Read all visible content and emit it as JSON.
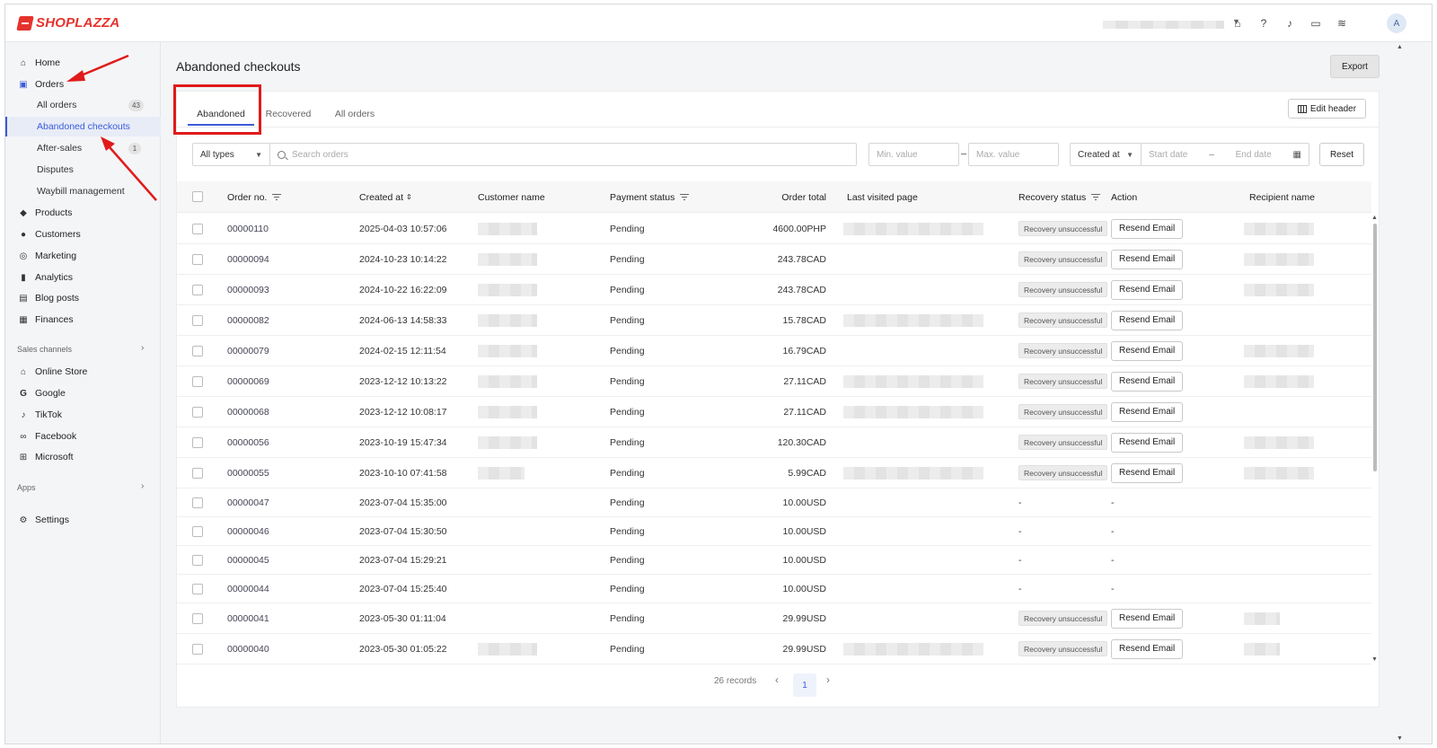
{
  "app": {
    "brand": "SHOPLAZZA",
    "avatar_initial": "A"
  },
  "topbar": {
    "icons": [
      "store-icon",
      "help-icon",
      "bell-icon",
      "chat-icon",
      "wifi-icon"
    ]
  },
  "sidebar": {
    "items": [
      {
        "label": "Home",
        "icon": "home-icon"
      },
      {
        "label": "Orders",
        "icon": "orders-icon"
      },
      {
        "label": "Products",
        "icon": "tag-icon"
      },
      {
        "label": "Customers",
        "icon": "person-icon"
      },
      {
        "label": "Marketing",
        "icon": "marketing-icon"
      },
      {
        "label": "Analytics",
        "icon": "bar-chart-icon"
      },
      {
        "label": "Blog posts",
        "icon": "blog-icon"
      },
      {
        "label": "Finances",
        "icon": "finance-icon"
      }
    ],
    "order_subitems": [
      {
        "label": "All orders",
        "badge": "43"
      },
      {
        "label": "Abandoned checkouts",
        "badge": ""
      },
      {
        "label": "After-sales",
        "badge": "1"
      },
      {
        "label": "Disputes",
        "badge": ""
      },
      {
        "label": "Waybill management",
        "badge": ""
      }
    ],
    "sales_channels_label": "Sales channels",
    "channels": [
      {
        "label": "Online Store",
        "icon": "storefront-icon"
      },
      {
        "label": "Google",
        "icon": "google-icon"
      },
      {
        "label": "TikTok",
        "icon": "tiktok-icon"
      },
      {
        "label": "Facebook",
        "icon": "meta-icon"
      },
      {
        "label": "Microsoft",
        "icon": "microsoft-icon"
      }
    ],
    "apps_label": "Apps",
    "settings_label": "Settings"
  },
  "page": {
    "title": "Abandoned checkouts",
    "export_label": "Export",
    "tabs": [
      "Abandoned",
      "Recovered",
      "All orders"
    ],
    "edit_header_label": "Edit header"
  },
  "filters": {
    "type_value": "All types",
    "search_placeholder": "Search orders",
    "min_placeholder": "Min. value",
    "max_placeholder": "Max. value",
    "date_field": "Created at",
    "start_placeholder": "Start date",
    "end_placeholder": "End date",
    "reset_label": "Reset"
  },
  "table": {
    "headers": {
      "order_no": "Order no.",
      "created_at": "Created at",
      "customer_name": "Customer name",
      "payment_status": "Payment status",
      "order_total": "Order total",
      "last_visited": "Last visited page",
      "recovery_status": "Recovery status",
      "action": "Action",
      "recipient": "Recipient name"
    },
    "rows": [
      {
        "order_no": "00000110",
        "created_at": "2025-04-03 10:57:06",
        "payment": "Pending",
        "total": "4600.00PHP",
        "recovery": "Recovery unsuccessful",
        "action": "Resend Email"
      },
      {
        "order_no": "00000094",
        "created_at": "2024-10-23 10:14:22",
        "payment": "Pending",
        "total": "243.78CAD",
        "recovery": "Recovery unsuccessful",
        "action": "Resend Email"
      },
      {
        "order_no": "00000093",
        "created_at": "2024-10-22 16:22:09",
        "payment": "Pending",
        "total": "243.78CAD",
        "recovery": "Recovery unsuccessful",
        "action": "Resend Email"
      },
      {
        "order_no": "00000082",
        "created_at": "2024-06-13 14:58:33",
        "payment": "Pending",
        "total": "15.78CAD",
        "recovery": "Recovery unsuccessful",
        "action": "Resend Email"
      },
      {
        "order_no": "00000079",
        "created_at": "2024-02-15 12:11:54",
        "payment": "Pending",
        "total": "16.79CAD",
        "recovery": "Recovery unsuccessful",
        "action": "Resend Email"
      },
      {
        "order_no": "00000069",
        "created_at": "2023-12-12 10:13:22",
        "payment": "Pending",
        "total": "27.11CAD",
        "recovery": "Recovery unsuccessful",
        "action": "Resend Email"
      },
      {
        "order_no": "00000068",
        "created_at": "2023-12-12 10:08:17",
        "payment": "Pending",
        "total": "27.11CAD",
        "recovery": "Recovery unsuccessful",
        "action": "Resend Email"
      },
      {
        "order_no": "00000056",
        "created_at": "2023-10-19 15:47:34",
        "payment": "Pending",
        "total": "120.30CAD",
        "recovery": "Recovery unsuccessful",
        "action": "Resend Email"
      },
      {
        "order_no": "00000055",
        "created_at": "2023-10-10 07:41:58",
        "payment": "Pending",
        "total": "5.99CAD",
        "recovery": "Recovery unsuccessful",
        "action": "Resend Email"
      },
      {
        "order_no": "00000047",
        "created_at": "2023-07-04 15:35:00",
        "payment": "Pending",
        "total": "10.00USD",
        "recovery": "-",
        "action": "-"
      },
      {
        "order_no": "00000046",
        "created_at": "2023-07-04 15:30:50",
        "payment": "Pending",
        "total": "10.00USD",
        "recovery": "-",
        "action": "-"
      },
      {
        "order_no": "00000045",
        "created_at": "2023-07-04 15:29:21",
        "payment": "Pending",
        "total": "10.00USD",
        "recovery": "-",
        "action": "-"
      },
      {
        "order_no": "00000044",
        "created_at": "2023-07-04 15:25:40",
        "payment": "Pending",
        "total": "10.00USD",
        "recovery": "-",
        "action": "-"
      },
      {
        "order_no": "00000041",
        "created_at": "2023-05-30 01:11:04",
        "payment": "Pending",
        "total": "29.99USD",
        "recovery": "Recovery unsuccessful",
        "action": "Resend Email"
      },
      {
        "order_no": "00000040",
        "created_at": "2023-05-30 01:05:22",
        "payment": "Pending",
        "total": "29.99USD",
        "recovery": "Recovery unsuccessful",
        "action": "Resend Email"
      }
    ]
  },
  "pagination": {
    "records": "26 records",
    "current_page": "1"
  },
  "colors": {
    "accent": "#3a5bd9",
    "annotation_red": "#e01b1b",
    "brand_red": "#e5322d"
  }
}
